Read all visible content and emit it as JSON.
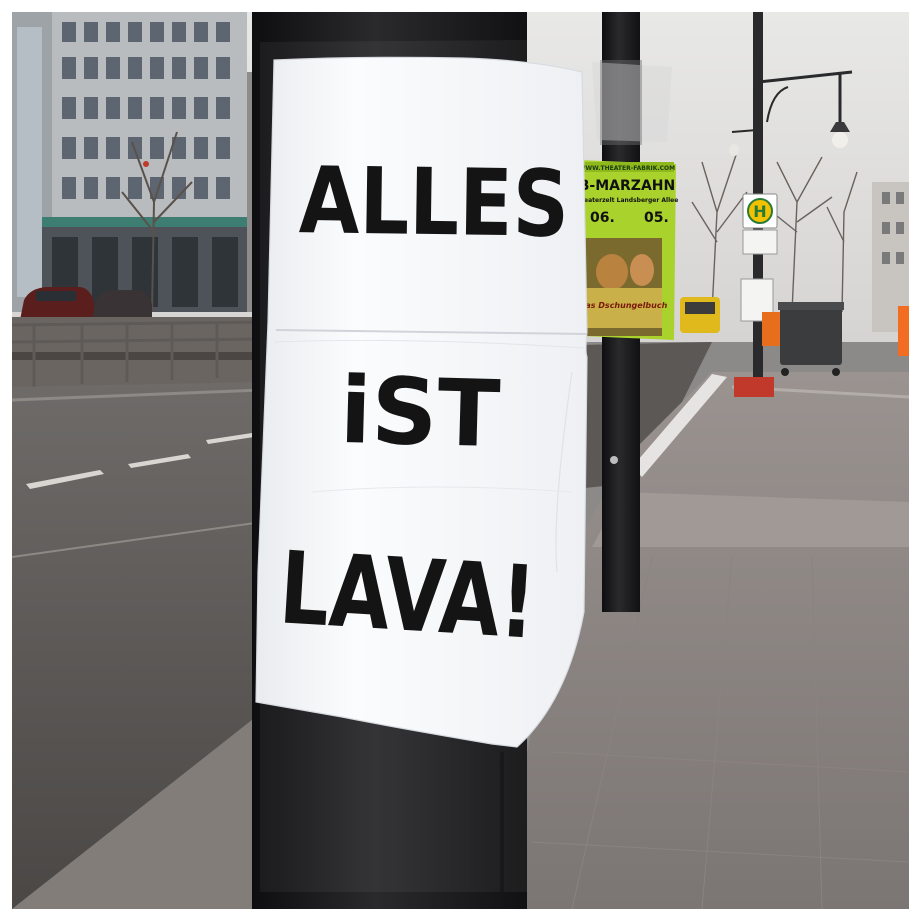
{
  "poster": {
    "line1": "ALLES",
    "line2": "iST",
    "line3": "LAVA!"
  },
  "side_poster": {
    "url": "WWW.THEATER-FABRIK.COM",
    "title": "B-MARZAHN",
    "subtitle": "Theaterzelt Landsberger Allee",
    "date_left": "06.",
    "date_right": "05.",
    "show_title": "Das Dschungelbuch"
  },
  "bus_stop_sign": {
    "letter": "H"
  },
  "colors": {
    "poster_paper": "#f6f7f9",
    "pole": "#1d1d1f",
    "side_poster_green": "#a9d22d",
    "bus_stop_yellow": "#f2c200",
    "sky": "#e2e2e0",
    "asphalt": "#4a4846",
    "sidewalk": "#8a8482"
  }
}
